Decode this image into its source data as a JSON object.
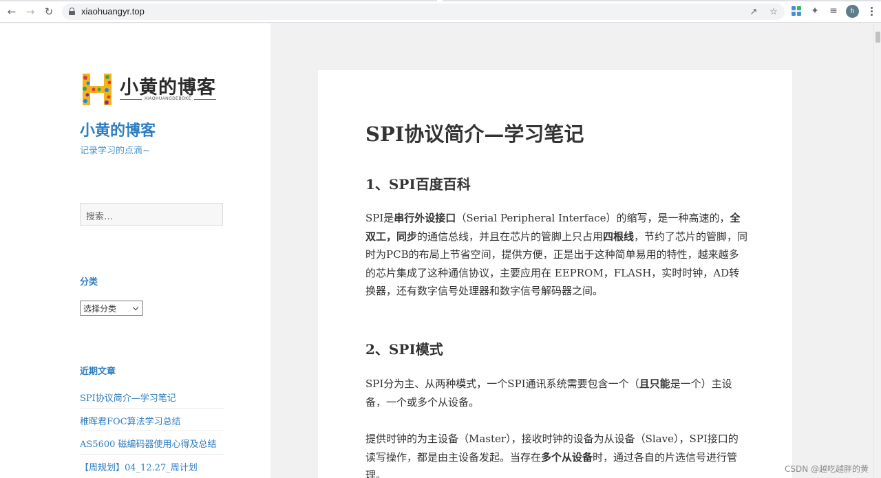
{
  "browser": {
    "url": "xiaohuangyr.top",
    "avatar_letter": "h"
  },
  "sidebar": {
    "logo_text": "小黄的博客",
    "logo_subtext": "XIAOHUANGDEBOKE",
    "site_title": "小黄的博客",
    "site_description": "记录学习的点滴~",
    "search_placeholder": "搜索…",
    "categories_title": "分类",
    "categories_select": "选择分类",
    "recent_title": "近期文章",
    "recent_posts": [
      "SPI协议简介—学习笔记",
      "稚晖君FOC算法学习总结",
      "AS5600 磁编码器使用心得及总结",
      "【周规划】04_12.27_周计划"
    ]
  },
  "article": {
    "title": "SPI协议简介—学习笔记",
    "section1_heading": "1、SPI百度百科",
    "p1": {
      "t1": "SPI是",
      "b1": "串行外设接口",
      "t2": "（Serial Peripheral Interface）的缩写，是一种高速的，",
      "b2": "全双工，同步",
      "t3": "的通信总线，并且在芯片的管脚上只占用",
      "b3": "四根线",
      "t4": "，节约了芯片的管脚，同时为PCB的布局上节省空间，提供方便，正是出于这种简单易用的特性，越来越多的芯片集成了这种通信协议，主要应用在 EEPROM，FLASH，实时时钟，AD转换器，还有数字信号处理器和数字信号解码器之间。"
    },
    "section2_heading": "2、SPI模式",
    "p2": {
      "t1": "SPI分为主、从两种模式，一个SPI通讯系统需要包含一个（",
      "b1": "且只能",
      "t2": "是一个）主设备，一个或多个从设备。"
    },
    "p3": {
      "t1": "提供时钟的为主设备（Master），接收时钟的设备为从设备（Slave），SPI接口的读写操作，都是由主设备发起。当存在",
      "b1": "多个从设备",
      "t2": "时，通过各自的片选信号进行管理。"
    }
  },
  "watermark": "CSDN @越吃越胖的黄",
  "colors": {
    "link": "#2d7ec1",
    "text": "#333333",
    "page_bg": "#f1f1f1"
  }
}
